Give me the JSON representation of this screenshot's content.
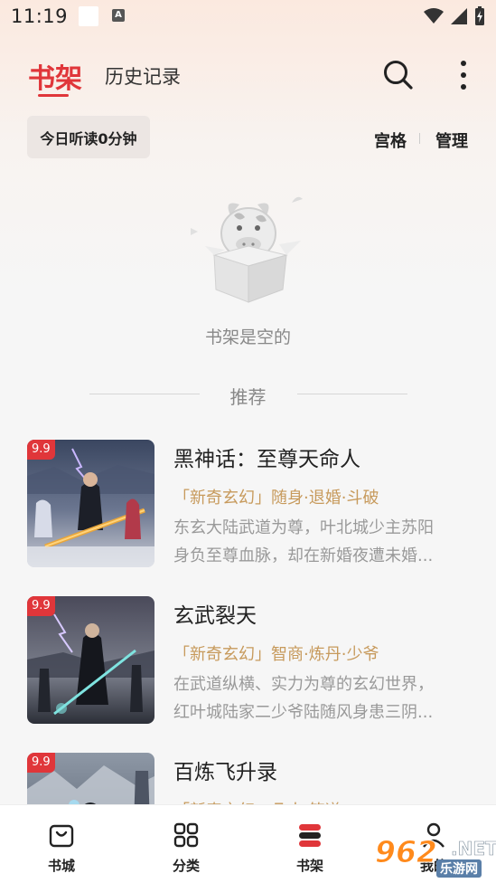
{
  "status_bar": {
    "time": "11:19"
  },
  "header": {
    "tab_active": "书架",
    "tab_history": "历史记录"
  },
  "toolbar": {
    "today_read": "今日听读0分钟",
    "grid": "宫格",
    "manage": "管理"
  },
  "empty_state": {
    "text": "书架是空的"
  },
  "recommend": {
    "label": "推荐",
    "books": [
      {
        "score": "9.9",
        "title": "黑神话：至尊天命人",
        "tags": "「新奇玄幻」随身·退婚·斗破",
        "desc_line1": "东玄大陆武道为尊，叶北城少主苏阳",
        "desc_line2": "身负至尊血脉，却在新婚夜遭未婚..."
      },
      {
        "score": "9.9",
        "title": "玄武裂天",
        "tags": "「新奇玄幻」智商·炼丹·少爷",
        "desc_line1": "在武道纵横、实力为尊的玄幻世界，",
        "desc_line2": "红叶城陆家二少爷陆随风身患三阴..."
      },
      {
        "score": "9.9",
        "title": "百炼飞升录",
        "tags": "「新奇玄幻」凡人·筑道",
        "desc_line1": "",
        "desc_line2": ""
      }
    ]
  },
  "bottom_nav": {
    "store": "书城",
    "category": "分类",
    "shelf": "书架",
    "mine": "我的"
  },
  "watermark": {
    "number": "962",
    "net": ".NET",
    "sub": "乐游网"
  },
  "colors": {
    "accent": "#e0363a",
    "tag": "#c79a5c"
  }
}
